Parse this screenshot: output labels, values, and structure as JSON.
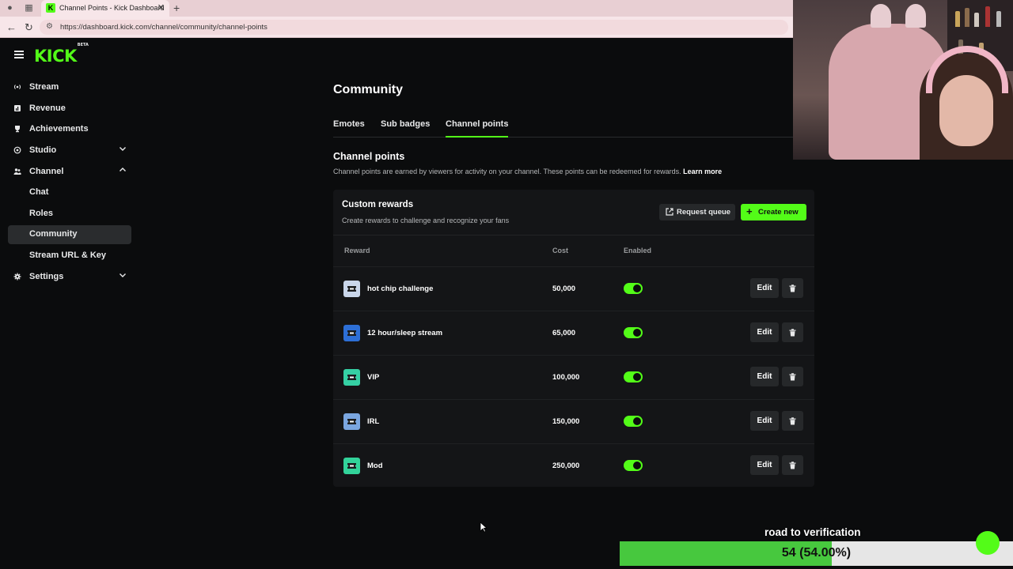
{
  "browser": {
    "tab_title": "Channel Points - Kick Dashboard",
    "url": "https://dashboard.kick.com/channel/community/channel-points"
  },
  "header": {
    "logo": "KICK",
    "logo_badge": "BETA"
  },
  "sidebar": {
    "items": [
      {
        "label": "Stream",
        "icon": "broadcast-icon"
      },
      {
        "label": "Revenue",
        "icon": "revenue-icon"
      },
      {
        "label": "Achievements",
        "icon": "trophy-icon"
      },
      {
        "label": "Studio",
        "icon": "studio-icon",
        "expanded": false
      },
      {
        "label": "Channel",
        "icon": "channel-icon",
        "expanded": true
      },
      {
        "label": "Chat"
      },
      {
        "label": "Roles"
      },
      {
        "label": "Community",
        "active": true
      },
      {
        "label": "Stream URL & Key"
      },
      {
        "label": "Settings",
        "icon": "gear-icon",
        "expanded": false
      }
    ]
  },
  "main": {
    "title": "Community",
    "tabs": [
      {
        "label": "Emotes"
      },
      {
        "label": "Sub badges"
      },
      {
        "label": "Channel points",
        "active": true
      }
    ],
    "section_title": "Channel points",
    "section_desc": "Channel points are earned by viewers for activity on your channel. These points can be redeemed for rewards.",
    "learn_more": "Learn more"
  },
  "rewards": {
    "title": "Custom rewards",
    "subtitle": "Create rewards to challenge and recognize your fans",
    "request_queue_label": "Request queue",
    "create_new_label": "Create new",
    "columns": [
      "Reward",
      "Cost",
      "Enabled"
    ],
    "edit_label": "Edit",
    "items": [
      {
        "name": "hot chip challenge",
        "cost": "50,000",
        "enabled": true,
        "color": "#c9d6ea"
      },
      {
        "name": "12 hour/sleep stream",
        "cost": "65,000",
        "enabled": true,
        "color": "#2d6fd6"
      },
      {
        "name": "VIP",
        "cost": "100,000",
        "enabled": true,
        "color": "#35d0a4"
      },
      {
        "name": "IRL",
        "cost": "150,000",
        "enabled": true,
        "color": "#7aa6e0"
      },
      {
        "name": "Mod",
        "cost": "250,000",
        "enabled": true,
        "color": "#32d39a"
      }
    ]
  },
  "overlay": {
    "goal_label": "road to verification",
    "goal_text": "54 (54.00%)",
    "goal_fraction": 0.54
  },
  "colors": {
    "accent": "#53fc18",
    "background": "#0b0c0d",
    "card": "#141517"
  }
}
